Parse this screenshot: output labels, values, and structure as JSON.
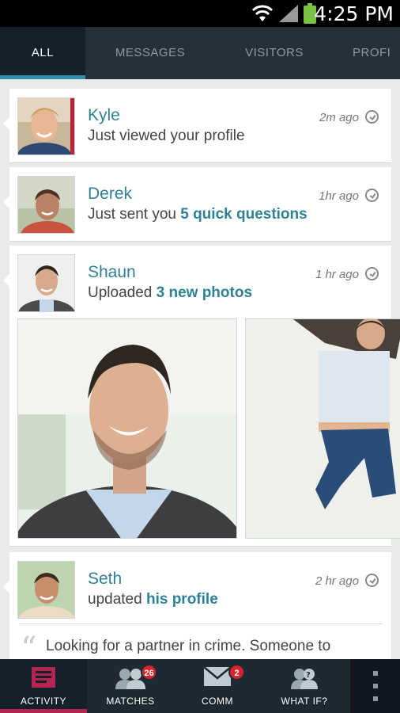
{
  "status_bar": {
    "time": "4:25 PM"
  },
  "tabs": [
    {
      "label": "ALL"
    },
    {
      "label": "MESSAGES"
    },
    {
      "label": "VISITORS"
    },
    {
      "label": "PROFI"
    }
  ],
  "feed": [
    {
      "name": "Kyle",
      "action": "Just viewed your profile",
      "highlight": "",
      "time": "2m ago"
    },
    {
      "name": "Derek",
      "action": "Just sent you ",
      "highlight": "5 quick questions",
      "time": "1hr ago"
    },
    {
      "name": "Shaun",
      "action": "Uploaded ",
      "highlight": "3 new photos",
      "time": "1 hr ago"
    },
    {
      "name": "Seth",
      "action": "updated ",
      "highlight": "his profile",
      "time": "2 hr ago",
      "quote": "Looking for a partner in crime. Someone to"
    }
  ],
  "bottom_nav": [
    {
      "label": "ACTIVITY",
      "icon": "activity-icon"
    },
    {
      "label": "MATCHES",
      "icon": "matches-icon",
      "badge": "26"
    },
    {
      "label": "COMM",
      "icon": "envelope-icon",
      "badge": "2"
    },
    {
      "label": "WHAT IF?",
      "icon": "what-if-icon"
    }
  ],
  "colors": {
    "accent": "#2f8196",
    "tab_bar": "#243139",
    "active_nav": "#b3264f",
    "badge": "#d9232e"
  }
}
